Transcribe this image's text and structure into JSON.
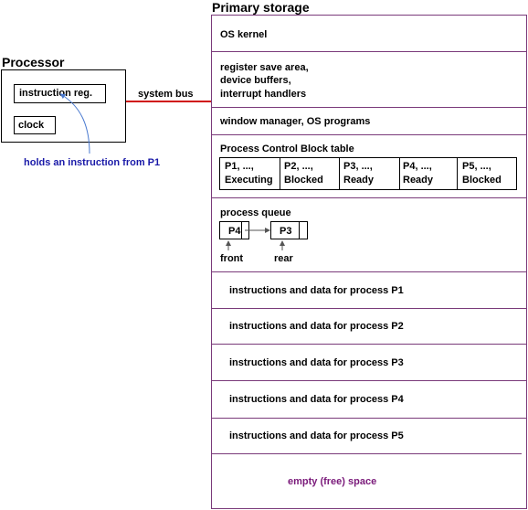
{
  "colors": {
    "bus": "#d01010",
    "separator": "#7a3a7a",
    "annotation": "#1a1aa8",
    "free_space": "#7a1a7a",
    "arrow": "#4a7ad0"
  },
  "processor": {
    "title": "Processor",
    "instruction_reg": "instruction reg.",
    "clock": "clock",
    "annotation": "holds an instruction from P1"
  },
  "bus_label": "system bus",
  "storage": {
    "title": "Primary storage",
    "os_kernel": "OS kernel",
    "system_areas": [
      "register save area,",
      "device buffers,",
      "interrupt handlers"
    ],
    "window_manager": "window manager, OS programs",
    "pcb_title": "Process Control Block table",
    "pcb": [
      {
        "name": "P1, ...,",
        "state": "Executing"
      },
      {
        "name": "P2, ...,",
        "state": "Blocked"
      },
      {
        "name": "P3, ...,",
        "state": "Ready"
      },
      {
        "name": "P4, ...,",
        "state": "Ready"
      },
      {
        "name": "P5, ...,",
        "state": "Blocked"
      }
    ],
    "queue": {
      "title": "process queue",
      "nodes": [
        "P4",
        "P3"
      ],
      "front_label": "front",
      "rear_label": "rear"
    },
    "process_regions": [
      "instructions and data for process P1",
      "instructions and data for process P2",
      "instructions and data for process P3",
      "instructions and data for process P4",
      "instructions and data for process P5"
    ],
    "free_space": "empty (free) space"
  }
}
